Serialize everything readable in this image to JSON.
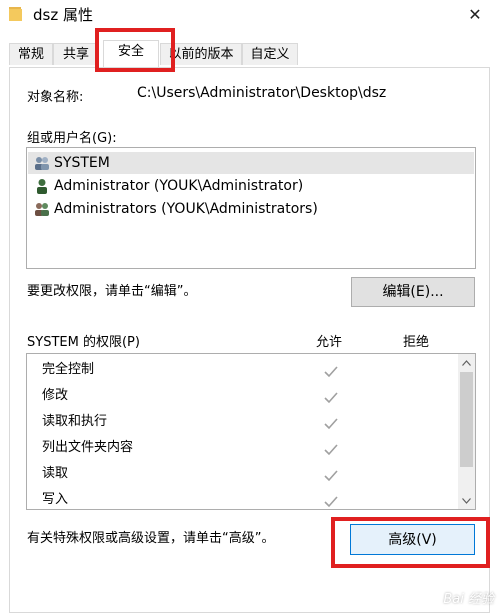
{
  "window": {
    "title": "dsz 属性",
    "close_glyph": "✕"
  },
  "tabs": [
    {
      "label": "常规"
    },
    {
      "label": "共享"
    },
    {
      "label": "安全"
    },
    {
      "label": "以前的版本"
    },
    {
      "label": "自定义"
    }
  ],
  "security": {
    "object_name_label": "对象名称:",
    "object_name_value": "C:\\Users\\Administrator\\Desktop\\dsz",
    "groups_label": "组或用户名(G):",
    "users": [
      {
        "name": "SYSTEM",
        "selected": true
      },
      {
        "name": "Administrator (YOUK\\Administrator)",
        "selected": false
      },
      {
        "name": "Administrators (YOUK\\Administrators)",
        "selected": false
      }
    ],
    "edit_hint": "要更改权限，请单击“编辑”。",
    "edit_button": "编辑(E)...",
    "permissions_label": "SYSTEM 的权限(P)",
    "allow_header": "允许",
    "deny_header": "拒绝",
    "permissions": [
      {
        "name": "完全控制",
        "allow": true,
        "deny": false
      },
      {
        "name": "修改",
        "allow": true,
        "deny": false
      },
      {
        "name": "读取和执行",
        "allow": true,
        "deny": false
      },
      {
        "name": "列出文件夹内容",
        "allow": true,
        "deny": false
      },
      {
        "name": "读取",
        "allow": true,
        "deny": false
      },
      {
        "name": "写入",
        "allow": true,
        "deny": false
      }
    ],
    "advanced_hint": "有关特殊权限或高级设置，请单击“高级”。",
    "advanced_button": "高级(V)"
  },
  "watermark": "Bai 经验",
  "colors": {
    "highlight": "#e02020",
    "check": "#a0a0a0",
    "selected_row": "#e5e5e5"
  }
}
